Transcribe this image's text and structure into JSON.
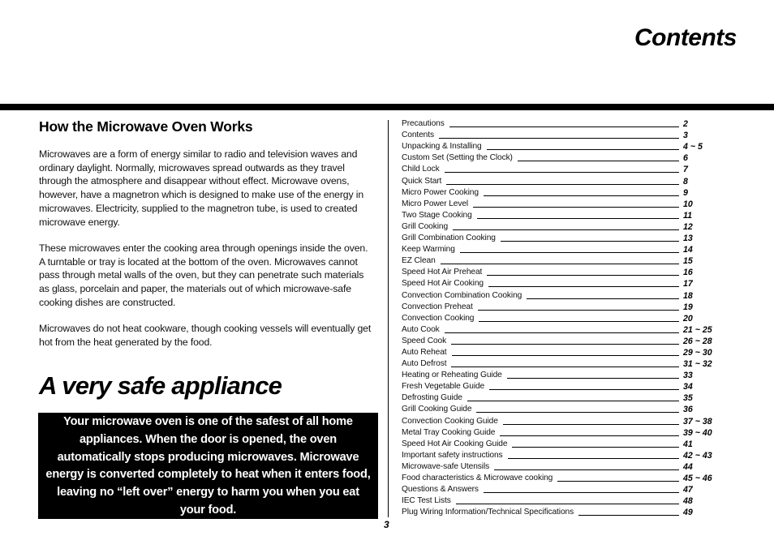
{
  "page": {
    "title": "Contents",
    "page_number": "3"
  },
  "left": {
    "heading": "How the Microwave Oven Works",
    "paragraphs": [
      "Microwaves are a form of energy similar to radio and television waves and ordinary daylight. Normally, microwaves spread outwards as they travel through the atmosphere and disappear without effect. Microwave ovens, however, have a magnetron which is designed to make use of the energy in microwaves. Electricity, supplied to the magnetron tube, is used to created microwave energy.",
      "These microwaves enter the cooking area through openings inside the oven. A turntable or tray is located at the bottom of the oven. Microwaves cannot pass through metal walls of the oven, but they can penetrate such materials as glass, porcelain and paper, the materials out of which microwave-safe cooking dishes are constructed.",
      "Microwaves do not heat cookware, though cooking vessels will eventually get hot from the heat generated by the food."
    ],
    "safety_heading": "A very safe appliance",
    "safety_callout": "Your microwave oven is one of the safest of all home appliances. When the door is opened, the oven automatically stops producing microwaves. Microwave energy is converted completely to heat when it enters food, leaving no “left  over” energy to harm you when you eat your food."
  },
  "toc": {
    "items": [
      {
        "label": "Precautions",
        "page": "2"
      },
      {
        "label": "Contents",
        "page": "3"
      },
      {
        "label": "Unpacking & Installing",
        "page": "4 ~ 5"
      },
      {
        "label": "Custom Set (Setting the Clock)",
        "page": "6"
      },
      {
        "label": "Child Lock",
        "page": "7"
      },
      {
        "label": "Quick Start",
        "page": "8"
      },
      {
        "label": "Micro Power Cooking",
        "page": "9"
      },
      {
        "label": "Micro Power Level",
        "page": "10"
      },
      {
        "label": "Two Stage Cooking",
        "page": "11"
      },
      {
        "label": "Grill Cooking",
        "page": "12"
      },
      {
        "label": "Grill Combination Cooking",
        "page": "13"
      },
      {
        "label": "Keep Warming",
        "page": "14"
      },
      {
        "label": "EZ Clean",
        "page": "15"
      },
      {
        "label": "Speed Hot Air Preheat",
        "page": "16"
      },
      {
        "label": "Speed Hot Air Cooking",
        "page": "17"
      },
      {
        "label": "Convection Combination Cooking",
        "page": "18"
      },
      {
        "label": "Convection Preheat",
        "page": "19"
      },
      {
        "label": "Convection Cooking",
        "page": "20"
      },
      {
        "label": "Auto Cook",
        "page": "21 ~ 25"
      },
      {
        "label": "Speed Cook",
        "page": "26 ~ 28"
      },
      {
        "label": "Auto Reheat",
        "page": "29 ~ 30"
      },
      {
        "label": "Auto Defrost",
        "page": "31 ~ 32"
      },
      {
        "label": "Heating or Reheating Guide",
        "page": "33"
      },
      {
        "label": "Fresh Vegetable Guide",
        "page": "34"
      },
      {
        "label": "Defrosting Guide",
        "page": "35"
      },
      {
        "label": "Grill Cooking Guide",
        "page": "36"
      },
      {
        "label": "Convection Cooking Guide",
        "page": "37 ~ 38"
      },
      {
        "label": "Metal Tray Cooking Guide",
        "page": "39 ~ 40"
      },
      {
        "label": "Speed Hot Air Cooking Guide",
        "page": "41"
      },
      {
        "label": "Important safety instructions",
        "page": "42 ~ 43"
      },
      {
        "label": "Microwave-safe Utensils",
        "page": "44"
      },
      {
        "label": "Food characteristics & Microwave cooking",
        "page": "45 ~ 46"
      },
      {
        "label": "Questions & Answers",
        "page": "47"
      },
      {
        "label": "IEC Test Lists",
        "page": "48"
      },
      {
        "label": "Plug Wiring Information/Technical Specifications",
        "page": "49"
      }
    ]
  }
}
